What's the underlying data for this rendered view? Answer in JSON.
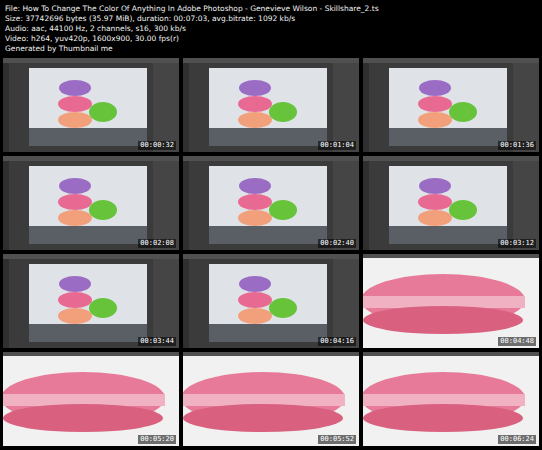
{
  "header": {
    "lines": [
      "File: How To Change The Color Of Anything In Adobe Photoshop - Genevieve Wilson - Skillshare_2.ts",
      "Size: 37742696 bytes (35.97 MiB), duration: 00:07:03, avg.bitrate: 1092 kb/s",
      "Audio: aac, 44100 Hz, 2 channels, s16, 300 kb/s",
      "Video: h264, yuv420p, 1600x900, 30.00 fps(r)",
      "Generated by Thumbnail me"
    ]
  },
  "frames": [
    {
      "time": "00:00:32",
      "kind": "stack"
    },
    {
      "time": "00:01:04",
      "kind": "stack"
    },
    {
      "time": "00:01:36",
      "kind": "stack"
    },
    {
      "time": "00:02:08",
      "kind": "stack"
    },
    {
      "time": "00:02:40",
      "kind": "stack"
    },
    {
      "time": "00:03:12",
      "kind": "stack"
    },
    {
      "time": "00:03:44",
      "kind": "stack"
    },
    {
      "time": "00:04:16",
      "kind": "stack"
    },
    {
      "time": "00:04:48",
      "kind": "closeup"
    },
    {
      "time": "00:05:20",
      "kind": "closeup"
    },
    {
      "time": "00:05:52",
      "kind": "closeup"
    },
    {
      "time": "00:06:24",
      "kind": "closeup"
    }
  ]
}
